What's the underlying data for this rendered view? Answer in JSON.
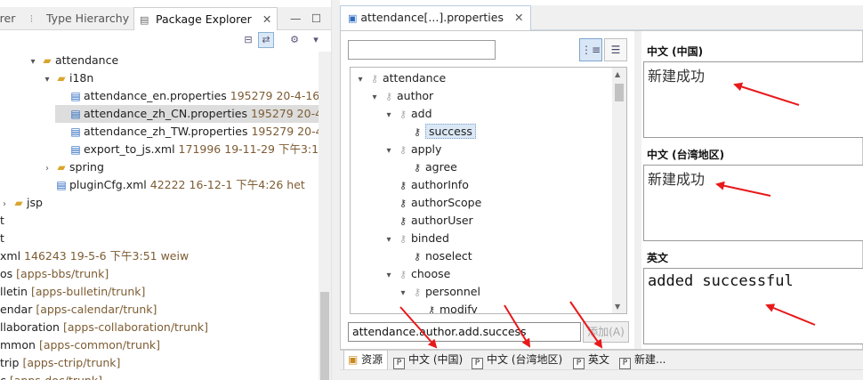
{
  "left_panel": {
    "tabs": [
      {
        "label": "orer",
        "icon": "navigator-icon"
      },
      {
        "label": "Type Hierarchy",
        "icon": "type-hierarchy-icon"
      },
      {
        "label": "Package Explorer",
        "icon": "package-explorer-icon"
      }
    ],
    "close_glyph": "✕",
    "minimize_glyph": "—",
    "maximize_glyph": "☐",
    "tree": [
      {
        "indent": 30,
        "twisty": "▾",
        "icon": "folder",
        "label": "attendance",
        "meta": ""
      },
      {
        "indent": 46,
        "twisty": "▾",
        "icon": "folder",
        "label": "i18n",
        "meta": ""
      },
      {
        "indent": 62,
        "twisty": "",
        "icon": "file",
        "label": "attendance_en.properties",
        "meta": "195279  20-4-16 下"
      },
      {
        "indent": 62,
        "twisty": "",
        "icon": "file",
        "label": "attendance_zh_CN.properties",
        "meta": "195279  20-4-1",
        "selected": true
      },
      {
        "indent": 62,
        "twisty": "",
        "icon": "file",
        "label": "attendance_zh_TW.properties",
        "meta": "195279  20-4-1"
      },
      {
        "indent": 62,
        "twisty": "",
        "icon": "file",
        "label": "export_to_js.xml",
        "meta": "171996  19-11-29 下午3:11  h"
      },
      {
        "indent": 46,
        "twisty": "›",
        "icon": "folder",
        "label": "spring",
        "meta": ""
      },
      {
        "indent": 46,
        "twisty": "",
        "icon": "file",
        "label": "pluginCfg.xml",
        "meta": "42222  16-12-1 下午4:26  het"
      },
      {
        "indent": -2,
        "twisty": "›",
        "icon": "folder",
        "label": "jsp",
        "meta": ""
      },
      {
        "indent": -14,
        "twisty": "",
        "icon": "",
        "label": "t",
        "meta": ""
      },
      {
        "indent": -14,
        "twisty": "",
        "icon": "",
        "label": "t",
        "meta": ""
      },
      {
        "indent": -14,
        "twisty": "",
        "icon": "",
        "label": "xml",
        "meta": "146243  19-5-6 下午3:51  weiw"
      },
      {
        "indent": -14,
        "twisty": "",
        "icon": "",
        "label": "os",
        "meta": "[apps-bbs/trunk]"
      },
      {
        "indent": -14,
        "twisty": "",
        "icon": "",
        "label": "lletin",
        "meta": "[apps-bulletin/trunk]"
      },
      {
        "indent": -14,
        "twisty": "",
        "icon": "",
        "label": "endar",
        "meta": "[apps-calendar/trunk]"
      },
      {
        "indent": -14,
        "twisty": "",
        "icon": "",
        "label": "llaboration",
        "meta": "[apps-collaboration/trunk]"
      },
      {
        "indent": -14,
        "twisty": "",
        "icon": "",
        "label": "mmon",
        "meta": "[apps-common/trunk]"
      },
      {
        "indent": -14,
        "twisty": "",
        "icon": "",
        "label": "trip",
        "meta": "[apps-ctrip/trunk]"
      },
      {
        "indent": -14,
        "twisty": "",
        "icon": "",
        "label": "c",
        "meta": "[apps-doc/trunk]"
      }
    ]
  },
  "editor": {
    "tab_title": "attendance[...].properties",
    "tab_close": "✕",
    "key_filter_value": "",
    "key_tree": [
      {
        "indent": 0,
        "twisty": "▾",
        "key_dim": true,
        "label": "attendance"
      },
      {
        "indent": 16,
        "twisty": "▾",
        "key_dim": true,
        "label": "author"
      },
      {
        "indent": 32,
        "twisty": "▾",
        "key_dim": true,
        "label": "add"
      },
      {
        "indent": 48,
        "twisty": "",
        "key_dim": false,
        "label": "success",
        "selected": true
      },
      {
        "indent": 32,
        "twisty": "▾",
        "key_dim": true,
        "label": "apply"
      },
      {
        "indent": 48,
        "twisty": "",
        "key_dim": false,
        "label": "agree"
      },
      {
        "indent": 32,
        "twisty": "",
        "key_dim": false,
        "label": "authorInfo"
      },
      {
        "indent": 32,
        "twisty": "",
        "key_dim": false,
        "label": "authorScope"
      },
      {
        "indent": 32,
        "twisty": "",
        "key_dim": false,
        "label": "authorUser"
      },
      {
        "indent": 32,
        "twisty": "▾",
        "key_dim": true,
        "label": "binded"
      },
      {
        "indent": 48,
        "twisty": "",
        "key_dim": false,
        "label": "noselect"
      },
      {
        "indent": 32,
        "twisty": "▾",
        "key_dim": true,
        "label": "choose"
      },
      {
        "indent": 48,
        "twisty": "▾",
        "key_dim": true,
        "label": "personnel"
      },
      {
        "indent": 64,
        "twisty": "",
        "key_dim": false,
        "label": "modify"
      }
    ],
    "new_key_input": "attendance.author.add.success",
    "add_button": "添加(A)",
    "languages": [
      {
        "label": "中文 (中国)",
        "value": "新建成功"
      },
      {
        "label": "中文 (台湾地区)",
        "value": "新建成功"
      },
      {
        "label": "英文",
        "value": "added successful"
      }
    ],
    "bottom_tabs": [
      {
        "label": "资源",
        "icon": "resources-icon"
      },
      {
        "label": "中文 (中国)",
        "icon": "properties-file-icon"
      },
      {
        "label": "中文 (台湾地区)",
        "icon": "properties-file-icon"
      },
      {
        "label": "英文",
        "icon": "properties-file-icon"
      },
      {
        "label": "新建...",
        "icon": "properties-file-icon"
      }
    ]
  },
  "annotations": {
    "arrow_color": "#e8191b"
  }
}
